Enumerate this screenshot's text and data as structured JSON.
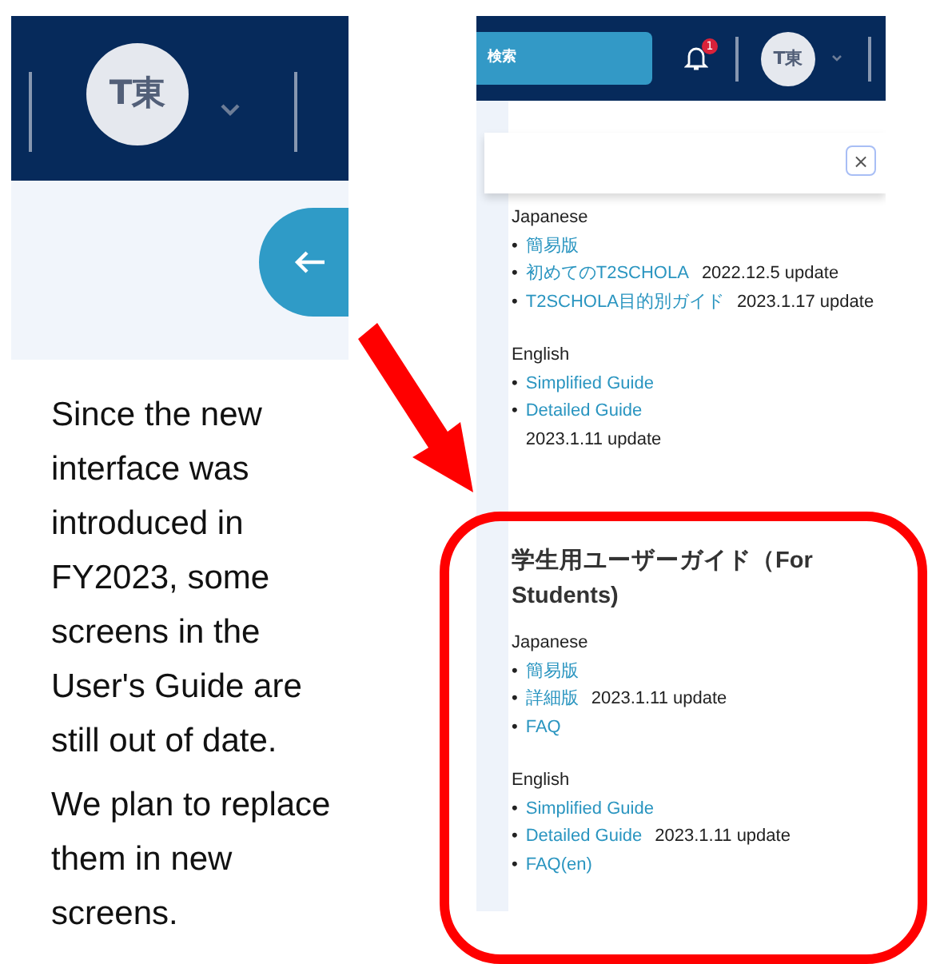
{
  "left_screenshot": {
    "avatar": "T東"
  },
  "caption": [
    "Since the new interface was introduced in FY2023, some screens in the User's Guide are still out of date.",
    "We plan to replace them in new screens."
  ],
  "right_screenshot": {
    "search_button": "検索",
    "notification_count": "1",
    "avatar": "T東",
    "close_button": "×",
    "sections": [
      {
        "groups": [
          {
            "language": "Japanese",
            "marker": "•",
            "items": [
              {
                "link": "簡易版"
              },
              {
                "link": "初めてのT2SCHOLA",
                "note": "2022.12.5 update"
              },
              {
                "link": "T2SCHOLA目的別ガイド",
                "note": "2023.1.17 update"
              }
            ]
          },
          {
            "language": "English",
            "marker": "•",
            "items": [
              {
                "link": "Simplified Guide"
              },
              {
                "link": "Detailed Guide",
                "note": "2023.1.11 update",
                "note_on_new_line": true
              }
            ]
          }
        ]
      },
      {
        "heading": "学生用ユーザーガイド（For Students)",
        "highlighted": true,
        "groups": [
          {
            "language": "Japanese",
            "marker": "•",
            "items": [
              {
                "link": "簡易版"
              },
              {
                "link": "詳細版",
                "note": "2023.1.11 update"
              },
              {
                "link": "FAQ"
              }
            ]
          },
          {
            "language": "English",
            "marker": "•",
            "items": [
              {
                "link": "Simplified Guide"
              },
              {
                "link": "Detailed Guide",
                "note": "2023.1.11 update"
              },
              {
                "link": "FAQ(en)"
              }
            ]
          }
        ]
      }
    ]
  }
}
